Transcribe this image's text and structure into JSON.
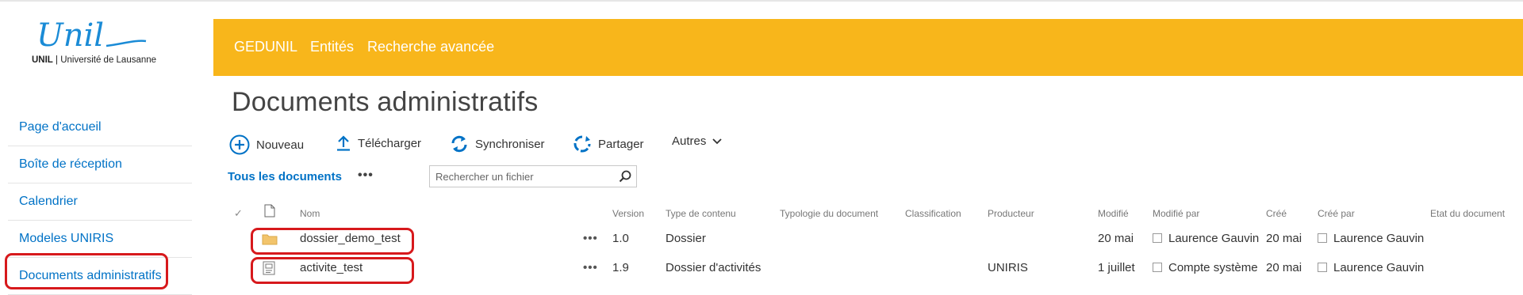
{
  "logo": {
    "wordmark": "Unil",
    "caption_bold": "UNIL",
    "caption_rest": " | Université de Lausanne"
  },
  "topbar": {
    "links": [
      "GEDUNIL",
      "Entités",
      "Recherche avancée"
    ],
    "color": "#f8b61b"
  },
  "sidebar": {
    "items": [
      {
        "label": "Page d'accueil"
      },
      {
        "label": "Boîte de réception"
      },
      {
        "label": "Calendrier"
      },
      {
        "label": "Modeles UNIRIS"
      },
      {
        "label": "Documents administratifs",
        "selected": true
      }
    ]
  },
  "page": {
    "title": "Documents administratifs"
  },
  "toolbar": {
    "new_label": "Nouveau",
    "upload_label": "Télécharger",
    "sync_label": "Synchroniser",
    "share_label": "Partager",
    "more_label": "Autres"
  },
  "view": {
    "name": "Tous les documents",
    "ellipsis": "•••"
  },
  "search": {
    "placeholder": "Rechercher un fichier"
  },
  "table": {
    "check_symbol": "✓",
    "columns": {
      "name": "Nom",
      "version": "Version",
      "content_type": "Type de contenu",
      "doc_typology": "Typologie du document",
      "classification": "Classification",
      "producer": "Producteur",
      "modified": "Modifié",
      "modified_by": "Modifié par",
      "created": "Créé",
      "created_by": "Créé par",
      "doc_state": "Etat du document"
    },
    "rows": [
      {
        "name": "dossier_demo_test",
        "icon": "folder-icon",
        "ellipsis": "•••",
        "version": "1.0",
        "content_type": "Dossier",
        "producer": "",
        "modified": "20 mai",
        "modified_by": "Laurence Gauvin",
        "created": "20 mai",
        "created_by": "Laurence Gauvin"
      },
      {
        "name": "activite_test",
        "icon": "activity-folder-icon",
        "ellipsis": "•••",
        "version": "1.9",
        "content_type": "Dossier d'activités",
        "producer": "UNIRIS",
        "modified": "1 juillet",
        "modified_by": "Compte système",
        "created": "20 mai",
        "created_by": "Laurence Gauvin"
      }
    ]
  },
  "colors": {
    "accent": "#0072c6",
    "highlight": "#d7191c"
  }
}
